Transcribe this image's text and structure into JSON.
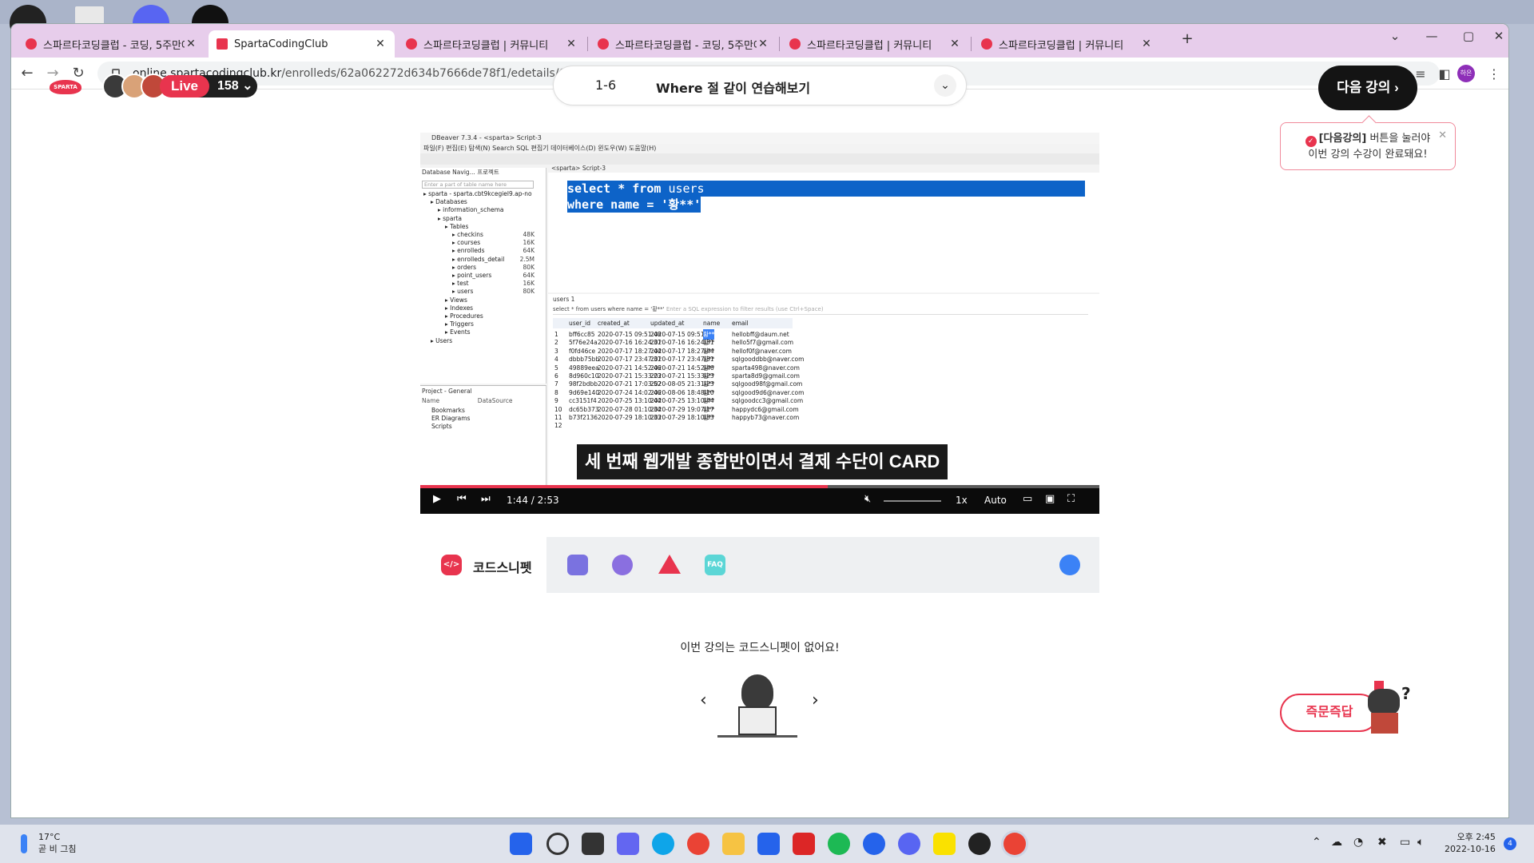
{
  "browser": {
    "tabs": [
      {
        "title": "스파르타코딩클럽 - 코딩, 5주만에",
        "active": false
      },
      {
        "title": "SpartaCodingClub",
        "active": true
      },
      {
        "title": "스파르타코딩클럽 | 커뮤니티",
        "active": false
      },
      {
        "title": "스파르타코딩클럽 - 코딩, 5주만에",
        "active": false
      },
      {
        "title": "스파르타코딩클럽 | 커뮤니티",
        "active": false
      },
      {
        "title": "스파르타코딩클럽 | 커뮤니티",
        "active": false
      }
    ],
    "url_host": "online.spartacodingclub.kr",
    "url_path": "/enrolleds/62a062272d634b7666de78f1/edetails/62a062272d634b7666de78fa?course_id=5f51cba7d76b11f9244d1111",
    "profile_initials": "하은"
  },
  "header": {
    "logo_text": "SPARTA",
    "live_label": "Live",
    "live_count": "158",
    "lesson_number": "1-6",
    "lesson_title": "Where 절 같이 연습해보기",
    "next_button": "다음 강의",
    "tooltip_highlight": "[다음강의]",
    "tooltip_line1": " 버튼을 눌러야",
    "tooltip_line2": "이번 강의 수강이 완료돼요!"
  },
  "video": {
    "dbeaver_title": "DBeaver 7.3.4 - <sparta> Script-3",
    "menu": "파일(F)  편집(E)  탐색(N)  Search  SQL 편집기  데이터베이스(D)  윈도우(W)  도움말(H)",
    "nav_header": "Database Navig...   프로젝트",
    "filter_placeholder": "Enter a part of table name here",
    "tree": [
      {
        "label": "sparta  - sparta.cbt9kcegiel9.ap-no",
        "indent": 0,
        "size": ""
      },
      {
        "label": "Databases",
        "indent": 1,
        "size": ""
      },
      {
        "label": "information_schema",
        "indent": 2,
        "size": ""
      },
      {
        "label": "sparta",
        "indent": 2,
        "size": ""
      },
      {
        "label": "Tables",
        "indent": 3,
        "size": ""
      },
      {
        "label": "checkins",
        "indent": 4,
        "size": "48K"
      },
      {
        "label": "courses",
        "indent": 4,
        "size": "16K"
      },
      {
        "label": "enrolleds",
        "indent": 4,
        "size": "64K"
      },
      {
        "label": "enrolleds_detail",
        "indent": 4,
        "size": "2.5M"
      },
      {
        "label": "orders",
        "indent": 4,
        "size": "80K"
      },
      {
        "label": "point_users",
        "indent": 4,
        "size": "64K"
      },
      {
        "label": "test",
        "indent": 4,
        "size": "16K"
      },
      {
        "label": "users",
        "indent": 4,
        "size": "80K"
      },
      {
        "label": "Views",
        "indent": 3,
        "size": ""
      },
      {
        "label": "Indexes",
        "indent": 3,
        "size": ""
      },
      {
        "label": "Procedures",
        "indent": 3,
        "size": ""
      },
      {
        "label": "Triggers",
        "indent": 3,
        "size": ""
      },
      {
        "label": "Events",
        "indent": 3,
        "size": ""
      },
      {
        "label": "Users",
        "indent": 1,
        "size": ""
      }
    ],
    "project_header": "Project - General",
    "project_cols": "Name                    DataSource",
    "project_items": [
      "Bookmarks",
      "ER Diagrams",
      "Scripts"
    ],
    "script_tab": "<sparta> Script-3",
    "sql_line1_kw": "select * from ",
    "sql_line1_rest": "users",
    "sql_line2": "where name = '황**'",
    "results_tab": "users 1",
    "results_query": "select * from users where name = '황**'",
    "results_filter": "Enter a SQL expression to filter results (use Ctrl+Space)",
    "columns": [
      "user_id",
      "created_at",
      "updated_at",
      "name",
      "email"
    ],
    "rows": [
      [
        "1",
        "bff6cc85",
        "2020-07-15 09:51:48",
        "2020-07-15 09:51:48",
        "황**",
        "hellobff@daum.net"
      ],
      [
        "2",
        "5f76e24a",
        "2020-07-16 16:24:31",
        "2020-07-16 16:24:31",
        "황**",
        "hello5f7@gmail.com"
      ],
      [
        "3",
        "f0fd46ce",
        "2020-07-17 18:27:44",
        "2020-07-17 18:27:44",
        "황**",
        "hellof0f@naver.com"
      ],
      [
        "4",
        "dbbb75bb",
        "2020-07-17 23:47:31",
        "2020-07-17 23:47:31",
        "황**",
        "sqlgooddbb@naver.com"
      ],
      [
        "5",
        "49889eea",
        "2020-07-21 14:52:46",
        "2020-07-21 14:52:46",
        "황**",
        "sparta498@naver.com"
      ],
      [
        "6",
        "8d960c10",
        "2020-07-21 15:33:23",
        "2020-07-21 15:33:23",
        "황**",
        "sparta8d9@gmail.com"
      ],
      [
        "7",
        "98f2bdbb",
        "2020-07-21 17:03:52",
        "2020-08-05 21:31:23",
        "황**",
        "sqlgood98f@gmail.com"
      ],
      [
        "8",
        "9d69e140",
        "2020-07-24 14:02:46",
        "2020-08-06 18:48:10",
        "황**",
        "sqlgood9d6@naver.com"
      ],
      [
        "9",
        "cc3151f4",
        "2020-07-25 13:10:44",
        "2020-07-25 13:10:44",
        "황**",
        "sqlgoodcc3@gmail.com"
      ],
      [
        "10",
        "dc65b373",
        "2020-07-28 01:10:34",
        "2020-07-29 19:07:17",
        "황**",
        "happydc6@gmail.com"
      ],
      [
        "11",
        "b73f2136",
        "2020-07-29 18:10:33",
        "2020-07-29 18:10:33",
        "황**",
        "happyb73@naver.com"
      ],
      [
        "12",
        "",
        "",
        "",
        "",
        ""
      ]
    ],
    "subtitle": "세 번째 웹개발 종합반이면서 결제 수단이 CARD",
    "time_current": "1:44",
    "time_sep": "/",
    "time_total": "2:53",
    "progress": 0.6,
    "speed": "1x",
    "quality": "Auto"
  },
  "snippet": {
    "tab_label": "코드스니펫",
    "faq_label": "FAQ",
    "empty_message": "이번 강의는 코드스니펫이 없어요!"
  },
  "qa_button": "즉문즉답",
  "taskbar": {
    "temperature": "17°C",
    "weather_desc": "곧 비 그침",
    "time": "오후 2:45",
    "date": "2022-10-16",
    "notification_count": "4"
  },
  "colors": {
    "accent": "#e8344e",
    "tabbar": "#e7cdeb",
    "selection": "#0d63c8"
  }
}
